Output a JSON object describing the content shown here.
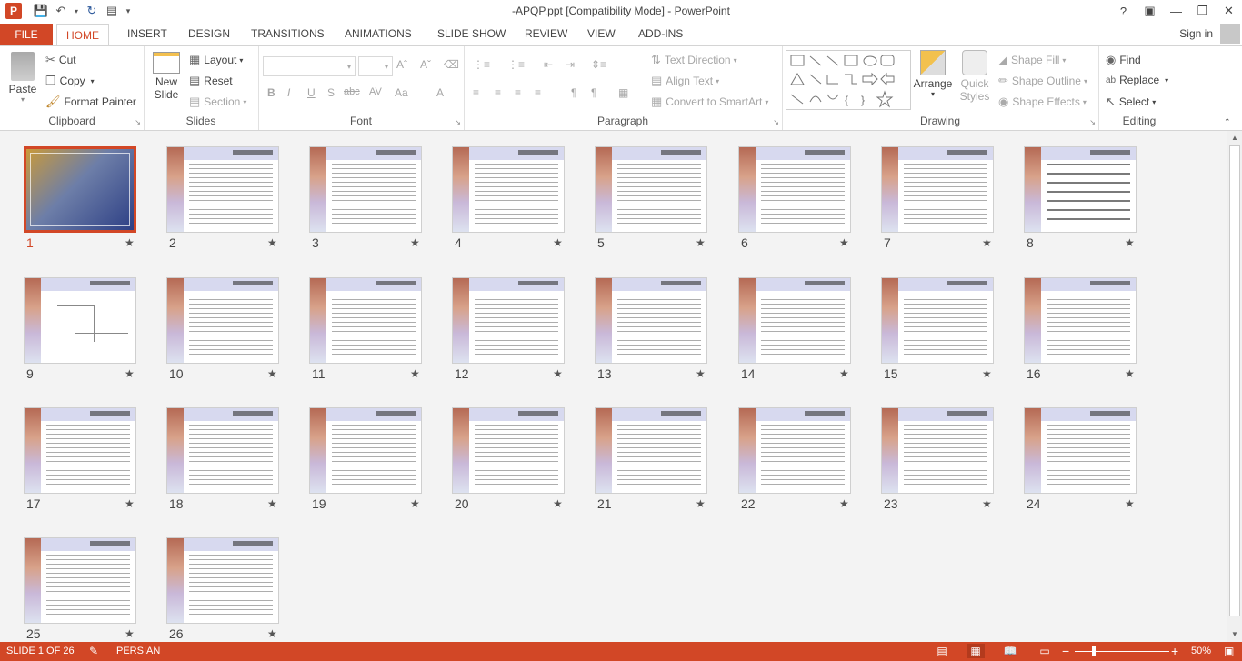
{
  "window": {
    "title": "-APQP.ppt [Compatibility Mode] - PowerPoint",
    "app_logo": "P",
    "help": "?",
    "sign_in": "Sign in"
  },
  "tabs": [
    {
      "label": "FILE",
      "active": false
    },
    {
      "label": "HOME",
      "active": true
    },
    {
      "label": "INSERT",
      "active": false
    },
    {
      "label": "DESIGN",
      "active": false
    },
    {
      "label": "TRANSITIONS",
      "active": false
    },
    {
      "label": "ANIMATIONS",
      "active": false
    },
    {
      "label": "SLIDE SHOW",
      "active": false
    },
    {
      "label": "REVIEW",
      "active": false
    },
    {
      "label": "VIEW",
      "active": false
    },
    {
      "label": "ADD-INS",
      "active": false
    }
  ],
  "ribbon": {
    "clipboard": {
      "label": "Clipboard",
      "paste": "Paste",
      "cut": "Cut",
      "copy": "Copy",
      "format_painter": "Format Painter"
    },
    "slides": {
      "label": "Slides",
      "new_slide_1": "New",
      "new_slide_2": "Slide",
      "layout": "Layout",
      "reset": "Reset",
      "section": "Section"
    },
    "font": {
      "label": "Font"
    },
    "paragraph": {
      "label": "Paragraph",
      "text_direction": "Text Direction",
      "align_text": "Align Text",
      "convert_smartart": "Convert to SmartArt"
    },
    "drawing": {
      "label": "Drawing",
      "arrange": "Arrange",
      "quick_styles_1": "Quick",
      "quick_styles_2": "Styles",
      "shape_fill": "Shape Fill",
      "shape_outline": "Shape Outline",
      "shape_effects": "Shape Effects"
    },
    "editing": {
      "label": "Editing",
      "find": "Find",
      "replace": "Replace",
      "select": "Select"
    }
  },
  "slides": [
    {
      "num": "1",
      "kind": "cover"
    },
    {
      "num": "2",
      "kind": "text"
    },
    {
      "num": "3",
      "kind": "text"
    },
    {
      "num": "4",
      "kind": "text"
    },
    {
      "num": "5",
      "kind": "text"
    },
    {
      "num": "6",
      "kind": "text"
    },
    {
      "num": "7",
      "kind": "text"
    },
    {
      "num": "8",
      "kind": "big"
    },
    {
      "num": "9",
      "kind": "diagram"
    },
    {
      "num": "10",
      "kind": "text"
    },
    {
      "num": "11",
      "kind": "text"
    },
    {
      "num": "12",
      "kind": "text"
    },
    {
      "num": "13",
      "kind": "text"
    },
    {
      "num": "14",
      "kind": "text"
    },
    {
      "num": "15",
      "kind": "text"
    },
    {
      "num": "16",
      "kind": "text"
    },
    {
      "num": "17",
      "kind": "text"
    },
    {
      "num": "18",
      "kind": "text"
    },
    {
      "num": "19",
      "kind": "text"
    },
    {
      "num": "20",
      "kind": "text"
    },
    {
      "num": "21",
      "kind": "text"
    },
    {
      "num": "22",
      "kind": "text"
    },
    {
      "num": "23",
      "kind": "text"
    },
    {
      "num": "24",
      "kind": "text"
    },
    {
      "num": "25",
      "kind": "text"
    },
    {
      "num": "26",
      "kind": "text"
    }
  ],
  "status": {
    "slide_info": "SLIDE 1 OF 26",
    "language": "PERSIAN",
    "zoom": "50%",
    "zoom_minus": "−",
    "zoom_plus": "+"
  },
  "colors": {
    "accent": "#d24726"
  },
  "icons": {
    "star": "★"
  }
}
